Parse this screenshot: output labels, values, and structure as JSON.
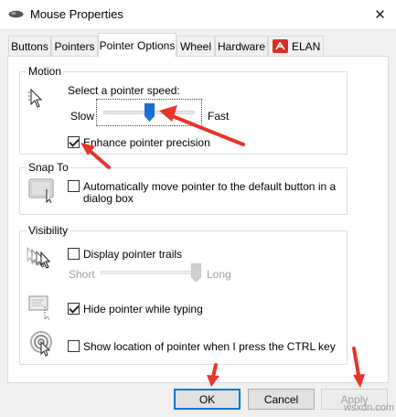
{
  "window": {
    "title": "Mouse Properties",
    "close_glyph": "✕"
  },
  "tabs": [
    {
      "label": "Buttons",
      "active": false
    },
    {
      "label": "Pointers",
      "active": false
    },
    {
      "label": "Pointer Options",
      "active": true
    },
    {
      "label": "Wheel",
      "active": false
    },
    {
      "label": "Hardware",
      "active": false
    },
    {
      "label": "ELAN",
      "active": false,
      "icon": "elan-logo-icon"
    }
  ],
  "motion": {
    "group_label": "Motion",
    "speed_label": "Select a pointer speed:",
    "slow_label": "Slow",
    "fast_label": "Fast",
    "speed_level": 0.5,
    "enhance_label": "Enhance pointer precision",
    "enhance_checked": true
  },
  "snap_to": {
    "group_label": "Snap To",
    "line1": "Automatically move pointer to the default button in a",
    "line2": "dialog box",
    "checked": false
  },
  "visibility": {
    "group_label": "Visibility",
    "trails_label": "Display pointer trails",
    "trails_checked": false,
    "short_label": "Short",
    "long_label": "Long",
    "trail_level": 1.0,
    "hide_label": "Hide pointer while typing",
    "hide_checked": true,
    "show_label": "Show location of pointer when I press the CTRL key",
    "show_checked": false
  },
  "buttons": {
    "ok": "OK",
    "cancel": "Cancel",
    "apply": "Apply"
  },
  "watermark": "wsxdn.com",
  "colors": {
    "annotation_arrow": "#e8342a",
    "slider_thumb": "#1a6fd1",
    "elan_red": "#d9302b"
  }
}
